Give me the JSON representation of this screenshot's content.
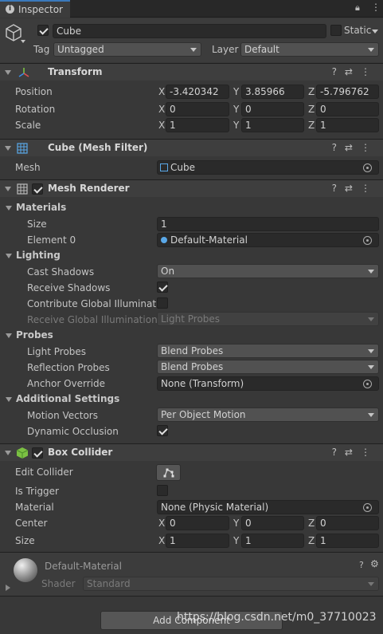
{
  "tab": {
    "label": "Inspector"
  },
  "object": {
    "name": "Cube",
    "static_label": "Static",
    "tag_label": "Tag",
    "tag_value": "Untagged",
    "layer_label": "Layer",
    "layer_value": "Default"
  },
  "transform": {
    "title": "Transform",
    "position_label": "Position",
    "rotation_label": "Rotation",
    "scale_label": "Scale",
    "position": [
      "-3.420342",
      "3.85966",
      "-5.796762"
    ],
    "rotation": [
      "0",
      "0",
      "0"
    ],
    "scale": [
      "1",
      "1",
      "1"
    ]
  },
  "axes": {
    "x": "X",
    "y": "Y",
    "z": "Z"
  },
  "mesh_filter": {
    "title": "Cube (Mesh Filter)",
    "mesh_label": "Mesh",
    "mesh_value": "Cube"
  },
  "mesh_renderer": {
    "title": "Mesh Renderer",
    "materials_label": "Materials",
    "size_label": "Size",
    "size_value": "1",
    "element0_label": "Element 0",
    "element0_value": "Default-Material",
    "lighting_label": "Lighting",
    "cast_shadows_label": "Cast Shadows",
    "cast_shadows_value": "On",
    "receive_shadows_label": "Receive Shadows",
    "contribute_gi_label": "Contribute Global Illumination",
    "receive_gi_label": "Receive Global Illumination",
    "receive_gi_value": "Light Probes",
    "probes_label": "Probes",
    "light_probes_label": "Light Probes",
    "light_probes_value": "Blend Probes",
    "reflection_probes_label": "Reflection Probes",
    "reflection_probes_value": "Blend Probes",
    "anchor_override_label": "Anchor Override",
    "anchor_override_value": "None (Transform)",
    "additional_label": "Additional Settings",
    "motion_vectors_label": "Motion Vectors",
    "motion_vectors_value": "Per Object Motion",
    "dynamic_occlusion_label": "Dynamic Occlusion"
  },
  "box_collider": {
    "title": "Box Collider",
    "edit_collider_label": "Edit Collider",
    "is_trigger_label": "Is Trigger",
    "material_label": "Material",
    "material_value": "None (Physic Material)",
    "center_label": "Center",
    "center": [
      "0",
      "0",
      "0"
    ],
    "size_label": "Size",
    "size": [
      "1",
      "1",
      "1"
    ]
  },
  "material": {
    "name": "Default-Material",
    "shader_label": "Shader",
    "shader_value": "Standard"
  },
  "add_component": {
    "label": "Add Component"
  },
  "watermark": "https://blog.csdn.net/m0_37710023"
}
